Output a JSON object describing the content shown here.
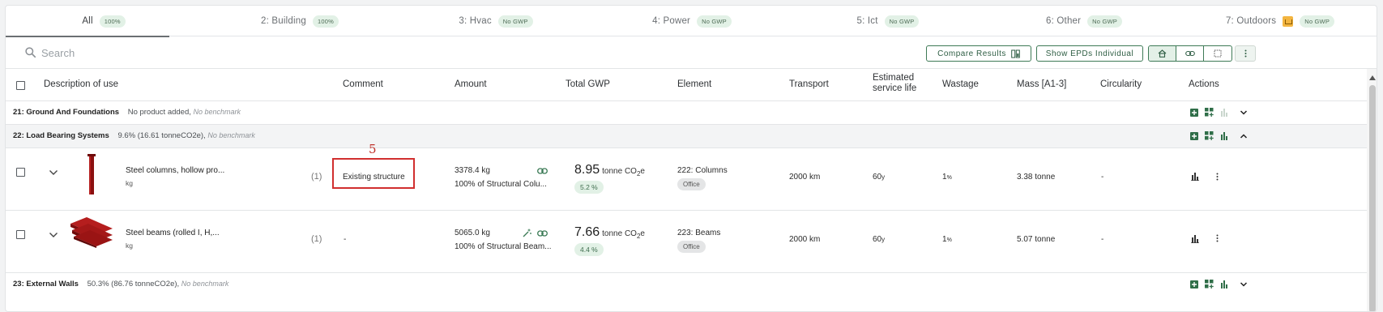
{
  "tabs": [
    {
      "label": "All",
      "badge": "100%"
    },
    {
      "label": "2: Building",
      "badge": "100%"
    },
    {
      "label": "3: Hvac",
      "badge": "No GWP"
    },
    {
      "label": "4: Power",
      "badge": "No GWP"
    },
    {
      "label": "5: Ict",
      "badge": "No GWP"
    },
    {
      "label": "6: Other",
      "badge": "No GWP"
    },
    {
      "label": "7: Outdoors",
      "badge": "No GWP"
    }
  ],
  "search": {
    "placeholder": "Search"
  },
  "toolbar": {
    "compare_label": "Compare Results",
    "show_epds_label": "Show EPDs Individual"
  },
  "columns": {
    "description": "Description of use",
    "comment": "Comment",
    "amount": "Amount",
    "total_gwp": "Total GWP",
    "element": "Element",
    "transport": "Transport",
    "service_life_1": "Estimated",
    "service_life_2": "service life",
    "wastage": "Wastage",
    "mass": "Mass [A1-3]",
    "circularity": "Circularity",
    "actions": "Actions"
  },
  "groups": [
    {
      "name": "21: Ground And Foundations",
      "info": "No product added,",
      "benchmark": "No benchmark"
    },
    {
      "name": "22: Load Bearing Systems",
      "info": "9.6% (16.61 tonneCO2e),",
      "benchmark": "No benchmark"
    },
    {
      "name": "23: External Walls",
      "info": "50.3% (86.76 tonneCO2e),",
      "benchmark": "No benchmark"
    }
  ],
  "products": [
    {
      "name": "Steel columns, hollow pro...",
      "unit": "kg",
      "count": "(1)",
      "comment": "Existing structure",
      "amount": "3378.4 kg",
      "amount_share": "100% of Structural Colu...",
      "gwp_value": "8.95",
      "gwp_unit_a": "tonne CO",
      "gwp_unit_sub": "2",
      "gwp_unit_b": "e",
      "gwp_pct": "5.2 %",
      "element": "222: Columns",
      "element_tag": "Office",
      "transport": "2000 km",
      "service_life": "60",
      "service_life_unit": "y",
      "wastage": "1",
      "wastage_unit": "%",
      "mass": "3.38 tonne",
      "circularity": "-"
    },
    {
      "name": "Steel beams (rolled I, H,...",
      "unit": "kg",
      "count": "(1)",
      "comment": "-",
      "amount": "5065.0 kg",
      "amount_share": "100% of Structural Beam...",
      "gwp_value": "7.66",
      "gwp_unit_a": "tonne CO",
      "gwp_unit_sub": "2",
      "gwp_unit_b": "e",
      "gwp_pct": "4.4 %",
      "element": "223: Beams",
      "element_tag": "Office",
      "transport": "2000 km",
      "service_life": "60",
      "service_life_unit": "y",
      "wastage": "1",
      "wastage_unit": "%",
      "mass": "5.07 tonne",
      "circularity": "-"
    }
  ],
  "annotation": {
    "number": "5"
  },
  "colors": {
    "accent": "#3e7a56",
    "badge_bg": "#e2f1e6",
    "annotation": "#d12f2f",
    "product_red": "#8b1010"
  }
}
